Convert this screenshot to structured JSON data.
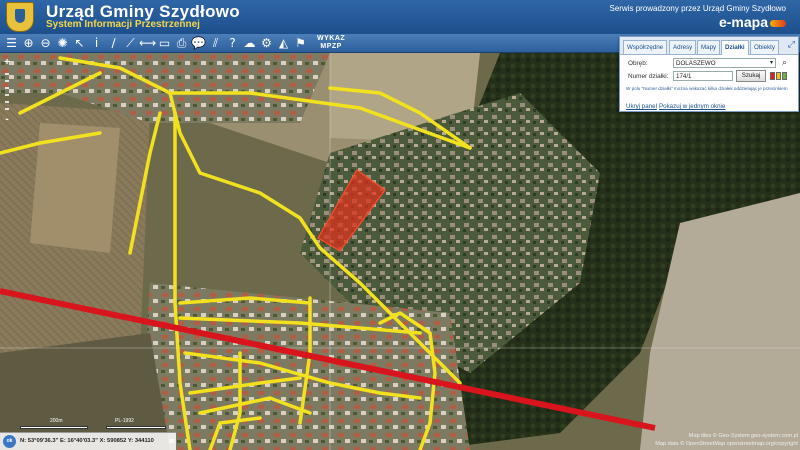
{
  "header": {
    "title": "Urząd Gminy Szydłowo",
    "subtitle": "System Informacji Przestrzennej",
    "service_note": "Serwis prowadzony przez Urząd Gminy Szydłowo",
    "brand": "e-mapa"
  },
  "toolbar": {
    "tools": [
      "layers-icon",
      "zoom-in-icon",
      "zoom-out-icon",
      "full-extent-icon",
      "select-arrow-icon",
      "info-icon",
      "draw-line-icon",
      "measure-icon",
      "distance-icon",
      "area-icon",
      "print-icon",
      "comment-icon",
      "hatch-icon",
      "help-icon",
      "cloud-icon",
      "settings-icon",
      "triangle-icon",
      "bookmark-icon"
    ],
    "tool_glyphs": [
      "☰",
      "⊕",
      "⊖",
      "✺",
      "↖",
      "i",
      "∕",
      "⟋",
      "⟷",
      "▭",
      "⎙",
      "💬",
      "⫽",
      "?",
      "☁",
      "⚙",
      "◭",
      "⚑"
    ],
    "wykaz_line1": "WYKAZ",
    "wykaz_line2": "MPZP"
  },
  "zoombar": {
    "plus": "+",
    "minus": "-"
  },
  "panel": {
    "tabs": [
      "Współrzędne",
      "Adresy",
      "Mapy",
      "Działki",
      "Obiekty"
    ],
    "active_tab": "Działki",
    "obreb_label": "Obręb:",
    "obreb_value": "DOLASZEWO",
    "numer_label": "Numer działki:",
    "numer_value": "174/1",
    "search_button": "Szukaj",
    "hint": "W polu \"Numer działki\" można wskazać kilka działek oddzielając je przecinkiem",
    "hide_link": "Ukryj panel",
    "single_window_link": "Pokazuj w jednym oknie",
    "swatch_colors": [
      "#e0201a",
      "#f2c21a",
      "#6db33f"
    ]
  },
  "scale": {
    "label": "200m",
    "projection": "PL-1992"
  },
  "status": {
    "ok_label": "ok",
    "coordinates": "N: 53°09'36.3\"  E: 16°40'03.3\"  X: 590852  Y: 344110"
  },
  "attribution": {
    "line1": "Map tiles © Geo-System geo-system.com.pl",
    "line2": "Map data © OpenStreetMap openstreetmap.org/copyright"
  },
  "colors": {
    "highlight_parcel": "#e0301c",
    "road": "#f2e11e",
    "railway": "#d8141c",
    "header_bg": "#1d4f8c"
  }
}
